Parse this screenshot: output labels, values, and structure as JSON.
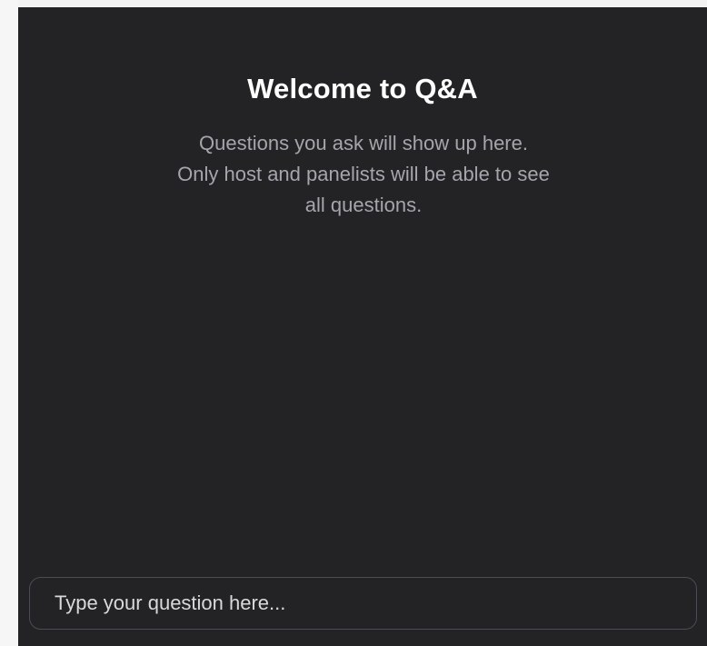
{
  "qa_panel": {
    "title": "Welcome to Q&A",
    "subtitle": "Questions you ask will show up here. Only host and panelists will be able to see all questions.",
    "question_input": {
      "value": "",
      "placeholder": "Type your question here..."
    }
  }
}
